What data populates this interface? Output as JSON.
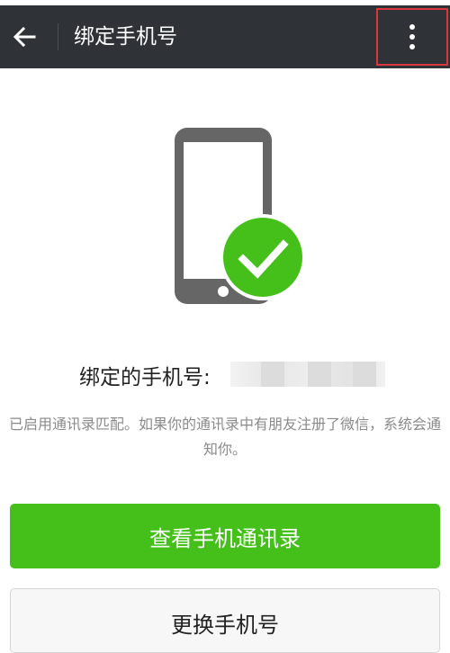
{
  "header": {
    "title": "绑定手机号",
    "back_icon": "back-arrow-icon",
    "more_icon": "more-vertical-icon"
  },
  "illustration": {
    "icon": "phone-check-icon",
    "phone_color": "#666666",
    "check_color": "#45c01a"
  },
  "binding": {
    "label": "绑定的手机号:",
    "number_masked": true
  },
  "info": {
    "message": "已启用通讯录匹配。如果你的通讯录中有朋友注册了微信，系统会通知你。"
  },
  "actions": {
    "view_contacts_label": "查看手机通讯录",
    "change_number_label": "更换手机号"
  },
  "colors": {
    "action_bar": "#2f3236",
    "primary": "#45c01a"
  }
}
